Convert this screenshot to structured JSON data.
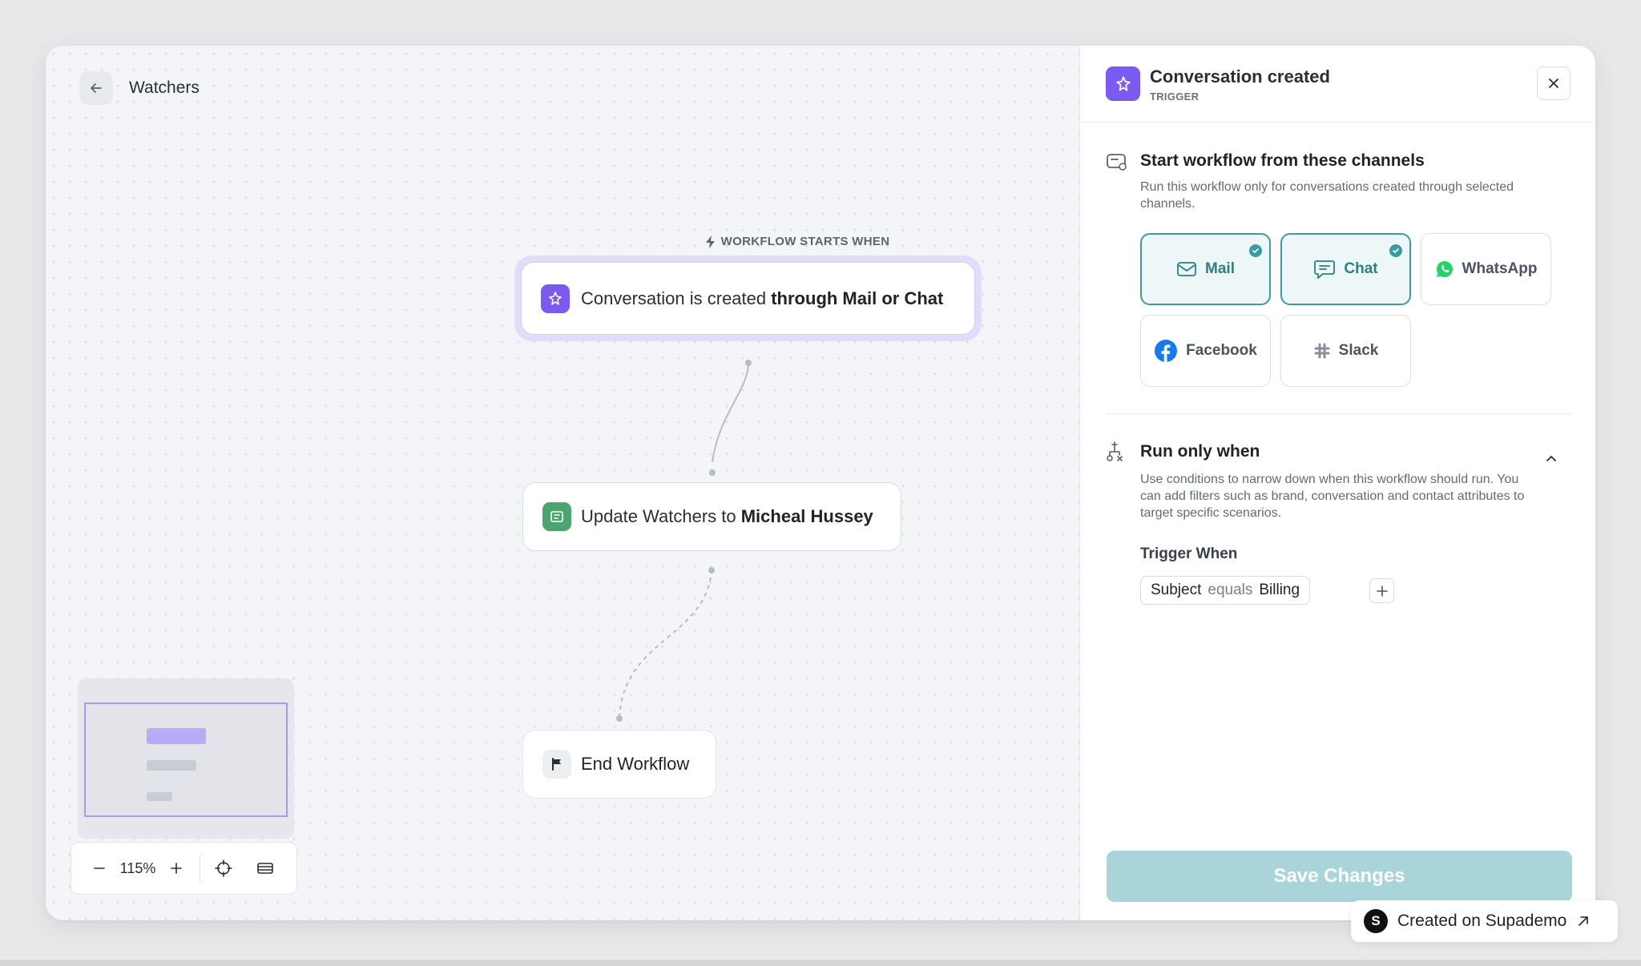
{
  "header": {
    "title": "Watchers"
  },
  "canvas": {
    "starts_label": "WORKFLOW STARTS WHEN",
    "trigger_node": {
      "text": "Conversation is created ",
      "bold": "through Mail or Chat"
    },
    "update_node": {
      "text": "Update Watchers to ",
      "bold": "Micheal Hussey"
    },
    "end_node": {
      "text": "End Workflow"
    },
    "zoom": {
      "value": "115%"
    }
  },
  "panel": {
    "title": "Conversation created",
    "subtitle": "TRIGGER",
    "channels_section": {
      "title": "Start workflow from these channels",
      "description": "Run this workflow only for conversations created through selected channels.",
      "channels": [
        {
          "label": "Mail",
          "selected": true
        },
        {
          "label": "Chat",
          "selected": true
        },
        {
          "label": "WhatsApp",
          "selected": false
        },
        {
          "label": "Facebook",
          "selected": false
        },
        {
          "label": "Slack",
          "selected": false
        }
      ]
    },
    "conditions_section": {
      "title": "Run only when",
      "description": "Use conditions to narrow down when this workflow should run. You can add filters such as brand, conversation and contact attributes to target specific scenarios.",
      "trigger_when_label": "Trigger When",
      "condition": {
        "field": "Subject",
        "operator": "equals",
        "value": "Billing"
      }
    },
    "save_label": "Save Changes"
  },
  "badge": {
    "label": "Created on Supademo"
  },
  "colors": {
    "accent_purple": "#7a5af0",
    "accent_teal": "#3e9a9e",
    "save_disabled": "#a9d5da"
  }
}
